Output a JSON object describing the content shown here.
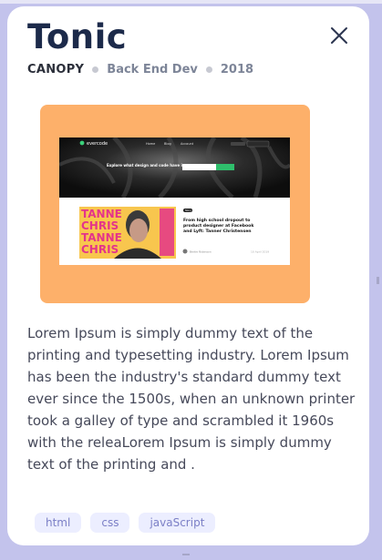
{
  "project": {
    "title": "Tonic",
    "company": "CANOPY",
    "role": "Back End Dev",
    "year": "2018",
    "description": "Lorem Ipsum is simply dummy text of the printing and typesetting industry. Lorem Ipsum has been the industry's standard dummy text ever since the 1500s, when an unknown printer took a galley of type and scrambled it 1960s with the releaLorem Ipsum is simply dummy text of the printing and .",
    "tags": [
      "html",
      "css",
      "javaScript"
    ]
  },
  "preview_site": {
    "brand": "evercode",
    "nav": [
      "Home",
      "Blog",
      "Account"
    ],
    "hero_text": "Explore what design and code have in common",
    "post_badge": "Story",
    "post_title": "From high school dropout to product designer at Facebook and Lyft: Tanner Christensen",
    "author": "Bertie Robinson",
    "date": "10 April 2019",
    "poster_text": "TANNER CHRISTENSEN"
  },
  "colors": {
    "title": "#1c2a4a",
    "preview_bg": "#fdb06a",
    "tag_bg": "#eceeff",
    "tag_text": "#7b7fc6",
    "backdrop": "#c3c3ec"
  },
  "icons": {
    "close": "close-icon"
  }
}
